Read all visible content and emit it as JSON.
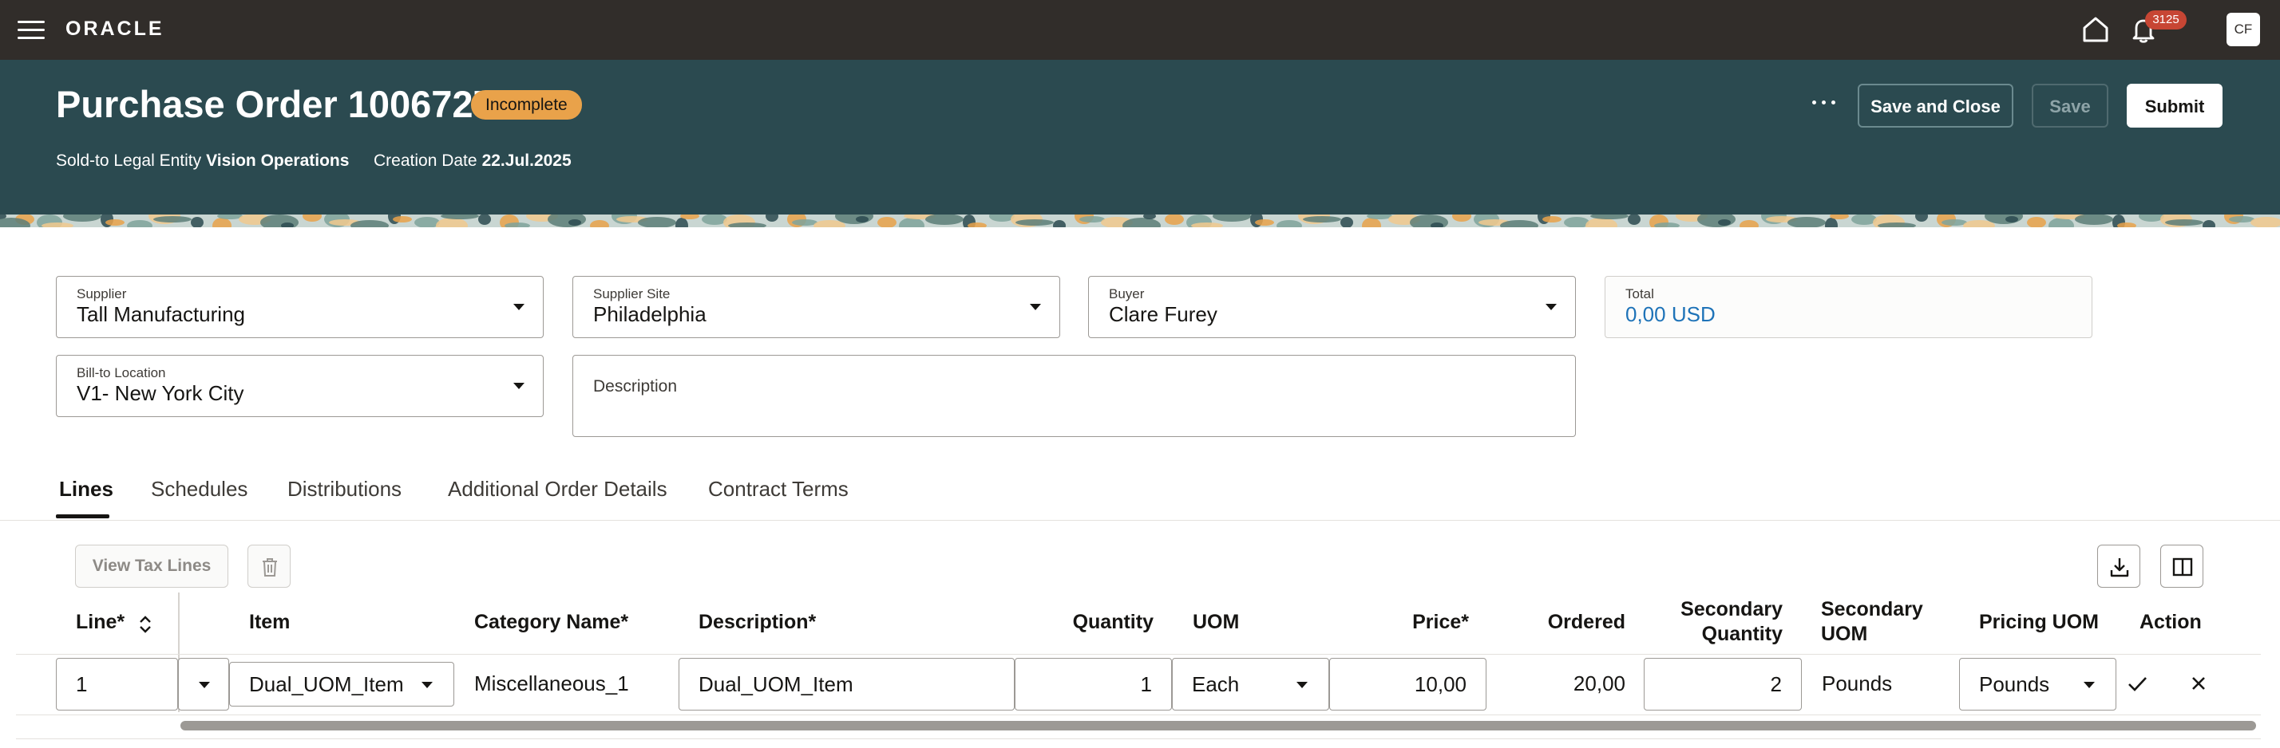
{
  "topbar": {
    "logo": "ORACLE",
    "notification_count": "3125",
    "user_initials": "CF"
  },
  "header": {
    "title": "Purchase Order 1006727",
    "status": "Incomplete",
    "legal_entity_label": "Sold-to Legal Entity",
    "legal_entity_value": "Vision Operations",
    "creation_date_label": "Creation Date",
    "creation_date_value": "22.Jul.2025",
    "buttons": {
      "save_and_close": "Save and Close",
      "save": "Save",
      "submit": "Submit"
    }
  },
  "form": {
    "supplier": {
      "label": "Supplier",
      "value": "Tall Manufacturing"
    },
    "supplier_site": {
      "label": "Supplier Site",
      "value": "Philadelphia"
    },
    "buyer": {
      "label": "Buyer",
      "value": "Clare Furey"
    },
    "total": {
      "label": "Total",
      "value": "0,00 USD"
    },
    "bill_to_location": {
      "label": "Bill-to Location",
      "value": "V1- New York City"
    },
    "description": {
      "label": "Description",
      "value": ""
    }
  },
  "tabs": [
    {
      "label": "Lines",
      "active": true
    },
    {
      "label": "Schedules",
      "active": false
    },
    {
      "label": "Distributions",
      "active": false
    },
    {
      "label": "Additional Order Details",
      "active": false
    },
    {
      "label": "Contract Terms",
      "active": false
    }
  ],
  "toolbar": {
    "view_tax_lines": "View Tax Lines"
  },
  "table": {
    "headers": {
      "line": "Line*",
      "item": "Item",
      "category_name": "Category Name*",
      "description": "Description*",
      "quantity": "Quantity",
      "uom": "UOM",
      "price": "Price*",
      "ordered": "Ordered",
      "secondary_quantity_1": "Secondary",
      "secondary_quantity_2": "Quantity",
      "secondary_uom_1": "Secondary",
      "secondary_uom_2": "UOM",
      "pricing_uom": "Pricing UOM",
      "action": "Action"
    },
    "rows": [
      {
        "line": "1",
        "item": "Dual_UOM_Item",
        "category_name": "Miscellaneous_1",
        "description": "Dual_UOM_Item",
        "quantity": "1",
        "uom": "Each",
        "price": "10,00",
        "ordered": "20,00",
        "secondary_quantity": "2",
        "secondary_uom": "Pounds",
        "pricing_uom": "Pounds"
      }
    ]
  },
  "colors": {
    "topbar": "#312d2a",
    "header_bg": "#2b4a50",
    "status_badge": "#e9a24a",
    "total_value": "#1e73b8",
    "notification_badge": "#c74634"
  },
  "icons": [
    "hamburger-icon",
    "home-icon",
    "bell-icon",
    "more-icon",
    "trash-icon",
    "export-icon",
    "columns-icon",
    "sort-icon",
    "chevron-down-icon",
    "check-icon",
    "close-icon"
  ]
}
